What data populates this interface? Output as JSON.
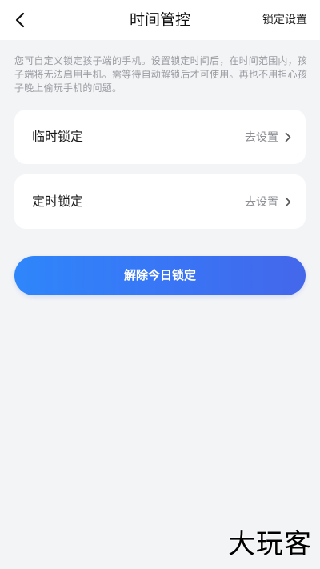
{
  "header": {
    "title": "时间管控",
    "right_action_label": "锁定设置",
    "back_icon": "chevron-left-icon"
  },
  "description": "您可自定义锁定孩子端的手机。设置锁定时间后，在时间范围内，孩子端将无法启用手机。需等待自动解锁后才可使用。再也不用担心孩子晚上偷玩手机的问题。",
  "cards": [
    {
      "label": "临时锁定",
      "action_label": "去设置",
      "icon": "chevron-right-icon"
    },
    {
      "label": "定时锁定",
      "action_label": "去设置",
      "icon": "chevron-right-icon"
    }
  ],
  "unlock_button": {
    "label": "解除今日锁定"
  },
  "watermark": "大玩客",
  "colors": {
    "background": "#f3f4f6",
    "card": "#ffffff",
    "button_gradient_start": "#2f86fb",
    "button_gradient_end": "#4467ea",
    "muted_text": "#9a9ca1"
  }
}
